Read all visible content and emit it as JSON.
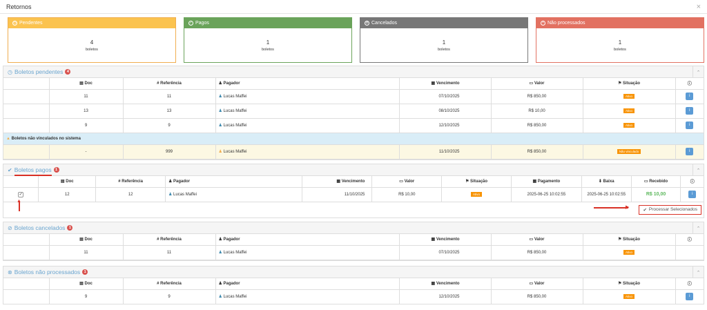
{
  "window": {
    "title": "Retornos",
    "close": "×"
  },
  "cards": [
    {
      "label": "Pendentes",
      "count": "4",
      "unit": "boletos",
      "color": "#f0ad4e",
      "bg": "#fbc34f",
      "icon": "clock-icon"
    },
    {
      "label": "Pagos",
      "count": "1",
      "unit": "boletos",
      "color": "#6aa35a",
      "bg": "#6aa35a",
      "icon": "check-icon"
    },
    {
      "label": "Cancelados",
      "count": "1",
      "unit": "boletos",
      "color": "#777",
      "bg": "#777777",
      "icon": "ban-icon"
    },
    {
      "label": "Não processados",
      "count": "1",
      "unit": "boletos",
      "color": "#e27161",
      "bg": "#e27161",
      "icon": "x-circle-icon"
    }
  ],
  "pendentes": {
    "title": "Boletos pendentes",
    "count": "4",
    "cols": [
      "Doc",
      "# Referência",
      "Pagador",
      "Vencimento",
      "Valor",
      "Situação"
    ],
    "rows": [
      {
        "doc": "11",
        "ref": "11",
        "pagador": "Lucas Maffei",
        "venc": "07/10/2025",
        "valor": "R$ 850,00",
        "sit": "Ativo"
      },
      {
        "doc": "13",
        "ref": "13",
        "pagador": "Lucas Maffei",
        "venc": "08/10/2025",
        "valor": "R$ 10,00",
        "sit": "Ativo"
      },
      {
        "doc": "9",
        "ref": "9",
        "pagador": "Lucas Maffei",
        "venc": "12/10/2025",
        "valor": "R$ 850,00",
        "sit": "Ativo"
      }
    ],
    "subheader": "Boletos não vinculados no sistema",
    "unlinked": {
      "doc": "-",
      "ref": "999",
      "pagador": "Lucas Maffei",
      "venc": "11/10/2025",
      "valor": "R$ 850,00",
      "sit": "Não vinculado"
    }
  },
  "pagos": {
    "title": "Boletos pagos",
    "count": "1",
    "cols": [
      "Doc",
      "# Referência",
      "Pagador",
      "Vencimento",
      "Valor",
      "Situação",
      "Pagamento",
      "Baixa",
      "Recebido"
    ],
    "row": {
      "doc": "12",
      "ref": "12",
      "pagador": "Lucas Maffei",
      "venc": "11/10/2025",
      "valor": "R$ 10,00",
      "sit": "Ativo",
      "pag": "2025-06-25 10:02:55",
      "baixa": "2025-06-25 10:02:55",
      "receb": "R$ 10,00"
    },
    "button": "Processar Selecionados"
  },
  "cancelados": {
    "title": "Boletos cancelados",
    "count": "1",
    "cols": [
      "Doc",
      "# Referência",
      "Pagador",
      "Vencimento",
      "Valor",
      "Situação"
    ],
    "row": {
      "doc": "11",
      "ref": "11",
      "pagador": "Lucas Maffei",
      "venc": "07/10/2025",
      "valor": "R$ 850,00",
      "sit": "Ativo"
    }
  },
  "naoproc": {
    "title": "Boletos não processados",
    "count": "1",
    "cols": [
      "Doc",
      "# Referência",
      "Pagador",
      "Vencimento",
      "Valor",
      "Situação"
    ],
    "row": {
      "doc": "9",
      "ref": "9",
      "pagador": "Lucas Maffei",
      "venc": "12/10/2025",
      "valor": "R$ 850,00",
      "sit": "Ativo"
    }
  }
}
